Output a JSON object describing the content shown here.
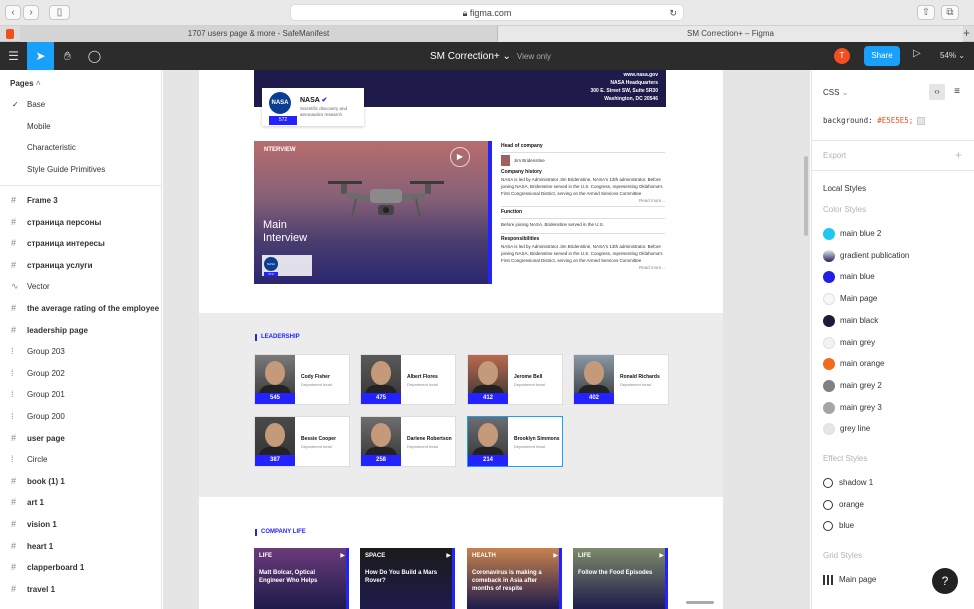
{
  "browser": {
    "url": "figma.com",
    "tabs": [
      "1707 users page & more - SafeManifest",
      "SM Correction+ – Figma"
    ]
  },
  "figma": {
    "file_title": "SM Correction+",
    "view_mode": "View only",
    "avatar_initial": "T",
    "share_label": "Share",
    "zoom": "54%"
  },
  "left": {
    "pages_title": "Pages",
    "pages": [
      "Base",
      "Mobile",
      "Characteristic",
      "Style Guide Primitives"
    ],
    "layers": [
      {
        "name": "Frame 3",
        "bold": true,
        "icon": "#"
      },
      {
        "name": "страница персоны",
        "bold": true,
        "icon": "#"
      },
      {
        "name": "страница интересы",
        "bold": true,
        "icon": "#"
      },
      {
        "name": "страница услуги",
        "bold": true,
        "icon": "#"
      },
      {
        "name": "Vector",
        "bold": false,
        "icon": "∿"
      },
      {
        "name": "the average rating of the employee",
        "bold": true,
        "icon": "#"
      },
      {
        "name": "leadership page",
        "bold": true,
        "icon": "#"
      },
      {
        "name": "Group 203",
        "bold": false,
        "icon": "⁞"
      },
      {
        "name": "Group 202",
        "bold": false,
        "icon": "⁞"
      },
      {
        "name": "Group 201",
        "bold": false,
        "icon": "⁞"
      },
      {
        "name": "Group 200",
        "bold": false,
        "icon": "⁞"
      },
      {
        "name": "user page",
        "bold": true,
        "icon": "#"
      },
      {
        "name": "Circle",
        "bold": false,
        "icon": "⁞"
      },
      {
        "name": "book (1) 1",
        "bold": true,
        "icon": "#"
      },
      {
        "name": "art 1",
        "bold": true,
        "icon": "#"
      },
      {
        "name": "vision 1",
        "bold": true,
        "icon": "#"
      },
      {
        "name": "heart 1",
        "bold": true,
        "icon": "#"
      },
      {
        "name": "clapperboard 1",
        "bold": true,
        "icon": "#"
      },
      {
        "name": "travel 1",
        "bold": true,
        "icon": "#"
      }
    ]
  },
  "canvas": {
    "header": {
      "address": [
        "www.nasa.gov",
        "NASA Headquarters",
        "300 E. Street SW, Suite 5R30",
        "Washington, DC 20546"
      ]
    },
    "company": {
      "logo": "NASA",
      "name": "NASA",
      "desc": "Scientific discovery and aeronautics research",
      "count": "572"
    },
    "interview": {
      "tag": "NTERVIEW",
      "title": "Main\nInterview",
      "badge_count": "572"
    },
    "info": {
      "head_label": "Head of company",
      "head_name": "Jim Bridenstine",
      "history_label": "Company history",
      "history_text": "NASA is led by Administrator Jim Bridenstine, NASA's 13th administrator. Before joining NASA, Bridenstine served in the U.S. Congress, representing Oklahoma's First Congressional District, serving on the Armed Services Committee",
      "read_more": "Read more...",
      "function_label": "Function",
      "function_text": "Before joining NASA, Bridenstine served in the U.S.",
      "resp_label": "Responsibilities",
      "resp_text": "NASA is led by Administrator Jim Bridenstine, NASA's 13th administrator. Before joining NASA, Bridenstine served in the U.S. Congress, representing Oklahoma's First Congressional District, serving on the Armed Services Committee"
    },
    "leadership_label": "LEADERSHIP",
    "leaders": [
      {
        "name": "Cody Fisher",
        "role": "Department head",
        "count": "545"
      },
      {
        "name": "Albert Flores",
        "role": "Department head",
        "count": "475"
      },
      {
        "name": "Jerome Bell",
        "role": "Department head",
        "count": "412"
      },
      {
        "name": "Ronald Richards",
        "role": "Department head",
        "count": "402"
      },
      {
        "name": "Bessie Cooper",
        "role": "Department head",
        "count": "387"
      },
      {
        "name": "Darlene Robertson",
        "role": "Department head",
        "count": "258"
      },
      {
        "name": "Brooklyn Simmons",
        "role": "Department head",
        "count": "214"
      }
    ],
    "company_life_label": "COMPANY LIFE",
    "life_cards": [
      {
        "category": "LIFE",
        "title": "Matt Bolcar, Optical Engineer Who Helps",
        "color": "#6a3b7a"
      },
      {
        "category": "SPACE",
        "title": "How Do You Build a Mars Rover?",
        "color": "#1b1b1b"
      },
      {
        "category": "HEALTH",
        "title": "Coronavirus is making a comeback in Asia after months of respite",
        "color": "#c8824d"
      },
      {
        "category": "LIFE",
        "title": "Follow the Food Episodes",
        "color": "#7d8a6a"
      }
    ]
  },
  "right": {
    "css_tab": "CSS",
    "css_property": "background:",
    "css_value": "#E5E5E5;",
    "export_label": "Export",
    "local_styles": "Local Styles",
    "color_styles": "Color Styles",
    "colors": [
      {
        "name": "main blue 2",
        "hex": "#1ec8f0"
      },
      {
        "name": "gradient publication",
        "hex": "#6a6aa0"
      },
      {
        "name": "main blue",
        "hex": "#1f1fe6"
      },
      {
        "name": "Main page",
        "hex": "#f7f7f7"
      },
      {
        "name": "main black",
        "hex": "#1b1b3a"
      },
      {
        "name": "main grey",
        "hex": "#f2f2f2"
      },
      {
        "name": "main orange",
        "hex": "#f26b1d"
      },
      {
        "name": "main grey 2",
        "hex": "#808080"
      },
      {
        "name": "main grey 3",
        "hex": "#a5a5a5"
      },
      {
        "name": "grey line",
        "hex": "#e6e6e6"
      }
    ],
    "effect_styles": "Effect Styles",
    "effects": [
      "shadow 1",
      "orange",
      "blue"
    ],
    "grid_styles": "Grid Styles",
    "grids": [
      "Main page"
    ]
  },
  "help": "?"
}
